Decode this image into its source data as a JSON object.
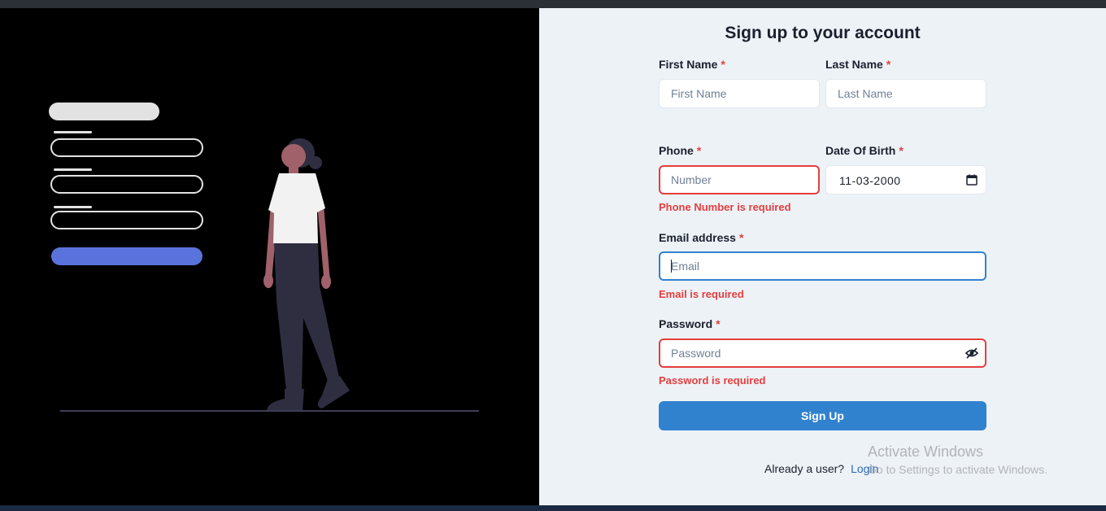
{
  "form": {
    "title": "Sign up to your account",
    "required_mark": "*",
    "first_name": {
      "label": "First Name",
      "placeholder": "First Name",
      "value": ""
    },
    "last_name": {
      "label": "Last Name",
      "placeholder": "Last Name",
      "value": ""
    },
    "phone": {
      "label": "Phone",
      "placeholder": "Number",
      "value": "",
      "error": "Phone Number is required"
    },
    "dob": {
      "label": "Date Of Birth",
      "value": "11-03-2000"
    },
    "email": {
      "label": "Email address",
      "placeholder": "Email",
      "value": "",
      "error": "Email is required"
    },
    "password": {
      "label": "Password",
      "placeholder": "Password",
      "value": "",
      "error": "Password is required"
    },
    "submit_label": "Sign Up",
    "footer_text": "Already a user?",
    "login_link": "Login"
  },
  "colors": {
    "accent": "#3182ce",
    "error": "#e53e3e",
    "left_background": "#000000",
    "right_background": "#edf2f7"
  },
  "watermark": {
    "line1": "Activate Windows",
    "line2": "Go to Settings to activate Windows."
  }
}
